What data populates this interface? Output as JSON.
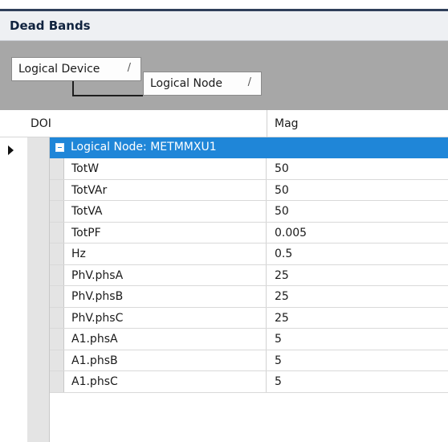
{
  "window": {
    "title": "Dead Bands"
  },
  "group_by": {
    "levels": [
      {
        "label": "Logical Device",
        "sort_icon": "sort-indicator-icon"
      },
      {
        "label": "Logical Node",
        "sort_icon": "sort-indicator-icon"
      }
    ]
  },
  "grid": {
    "columns": {
      "doi": "DOI",
      "mag": "Mag"
    },
    "group_row": {
      "label": "Logical Node: METMMXU1",
      "expander_icon": "collapse-minus-icon"
    },
    "rows": [
      {
        "name": "TotW",
        "value": "50"
      },
      {
        "name": "TotVAr",
        "value": "50"
      },
      {
        "name": "TotVA",
        "value": "50"
      },
      {
        "name": "TotPF",
        "value": "0.005"
      },
      {
        "name": "Hz",
        "value": "0.5"
      },
      {
        "name": "PhV.phsA",
        "value": "25"
      },
      {
        "name": "PhV.phsB",
        "value": "25"
      },
      {
        "name": "PhV.phsC",
        "value": "25"
      },
      {
        "name": "A1.phsA",
        "value": "5"
      },
      {
        "name": "A1.phsB",
        "value": "5"
      },
      {
        "name": "A1.phsC",
        "value": "5"
      }
    ]
  },
  "colors": {
    "selection": "#1f86d8",
    "group_panel": "#a7a7a7",
    "title_text": "#10233f"
  }
}
